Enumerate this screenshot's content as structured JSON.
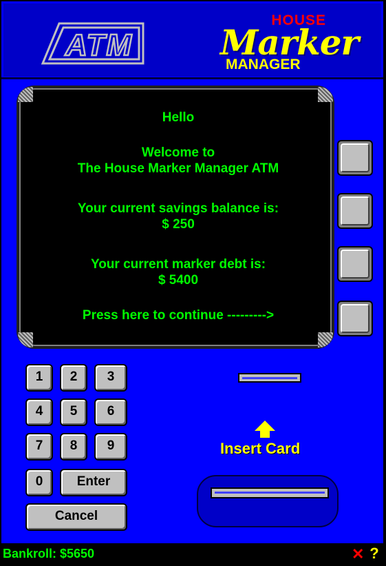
{
  "logos": {
    "atm": "ATM",
    "house": "HOUSE",
    "marker": "Marker",
    "manager": "MANAGER"
  },
  "screen": {
    "greeting": "Hello",
    "welcome_line1": "Welcome to",
    "welcome_line2": "The House Marker Manager ATM",
    "savings_label": "Your current savings balance is:",
    "savings_value": "$ 250",
    "debt_label": "Your current marker debt is:",
    "debt_value": "$ 5400",
    "continue_text": "Press here to continue --------->"
  },
  "keypad": {
    "keys": [
      "1",
      "2",
      "3",
      "4",
      "5",
      "6",
      "7",
      "8",
      "9",
      "0"
    ],
    "enter": "Enter",
    "cancel": "Cancel"
  },
  "card": {
    "insert_label": "Insert Card"
  },
  "status": {
    "bankroll": "Bankroll: $5650"
  },
  "icons": {
    "close": "✕",
    "help": "?"
  },
  "colors": {
    "panel": "#0000ff",
    "screen_text": "#00ff00",
    "accent_yellow": "#ffff00",
    "accent_red": "#ff0000"
  }
}
